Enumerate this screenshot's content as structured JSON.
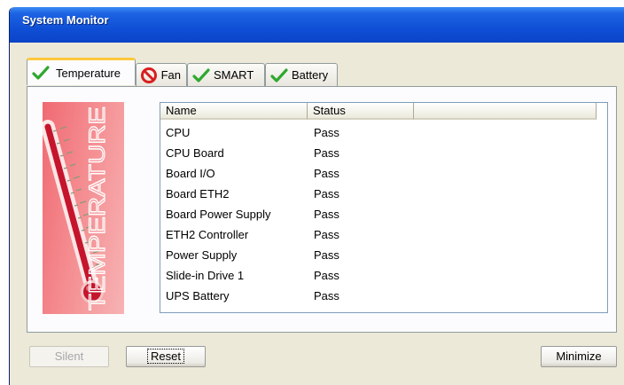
{
  "window": {
    "title": "System Monitor"
  },
  "tabs": [
    {
      "label": "Temperature",
      "icon": "check-icon",
      "status_color": "#2fa82f",
      "active": true
    },
    {
      "label": "Fan",
      "icon": "no-entry-icon",
      "status_color": "#d81e1e",
      "active": false
    },
    {
      "label": "SMART",
      "icon": "check-icon",
      "status_color": "#2fa82f",
      "active": false
    },
    {
      "label": "Battery",
      "icon": "check-icon",
      "status_color": "#2fa82f",
      "active": false
    }
  ],
  "banner": {
    "text": "TEMPERATURE",
    "icon": "thermometer-icon"
  },
  "table": {
    "columns": [
      "Name",
      "Status",
      ""
    ],
    "rows": [
      {
        "name": "CPU",
        "status": "Pass"
      },
      {
        "name": "CPU Board",
        "status": "Pass"
      },
      {
        "name": "Board I/O",
        "status": "Pass"
      },
      {
        "name": "Board ETH2",
        "status": "Pass"
      },
      {
        "name": "Board Power Supply",
        "status": "Pass"
      },
      {
        "name": "ETH2 Controller",
        "status": "Pass"
      },
      {
        "name": "Power Supply",
        "status": "Pass"
      },
      {
        "name": "Slide-in Drive 1",
        "status": "Pass"
      },
      {
        "name": "UPS Battery",
        "status": "Pass"
      }
    ]
  },
  "buttons": {
    "silent": {
      "label": "Silent",
      "enabled": false
    },
    "reset": {
      "label": "Reset",
      "enabled": true
    },
    "minimize": {
      "label": "Minimize",
      "enabled": true
    }
  },
  "colors": {
    "titlebar": "#0f4fd6",
    "active_tab_highlight": "#ffc83c",
    "banner": "#f06a72"
  }
}
